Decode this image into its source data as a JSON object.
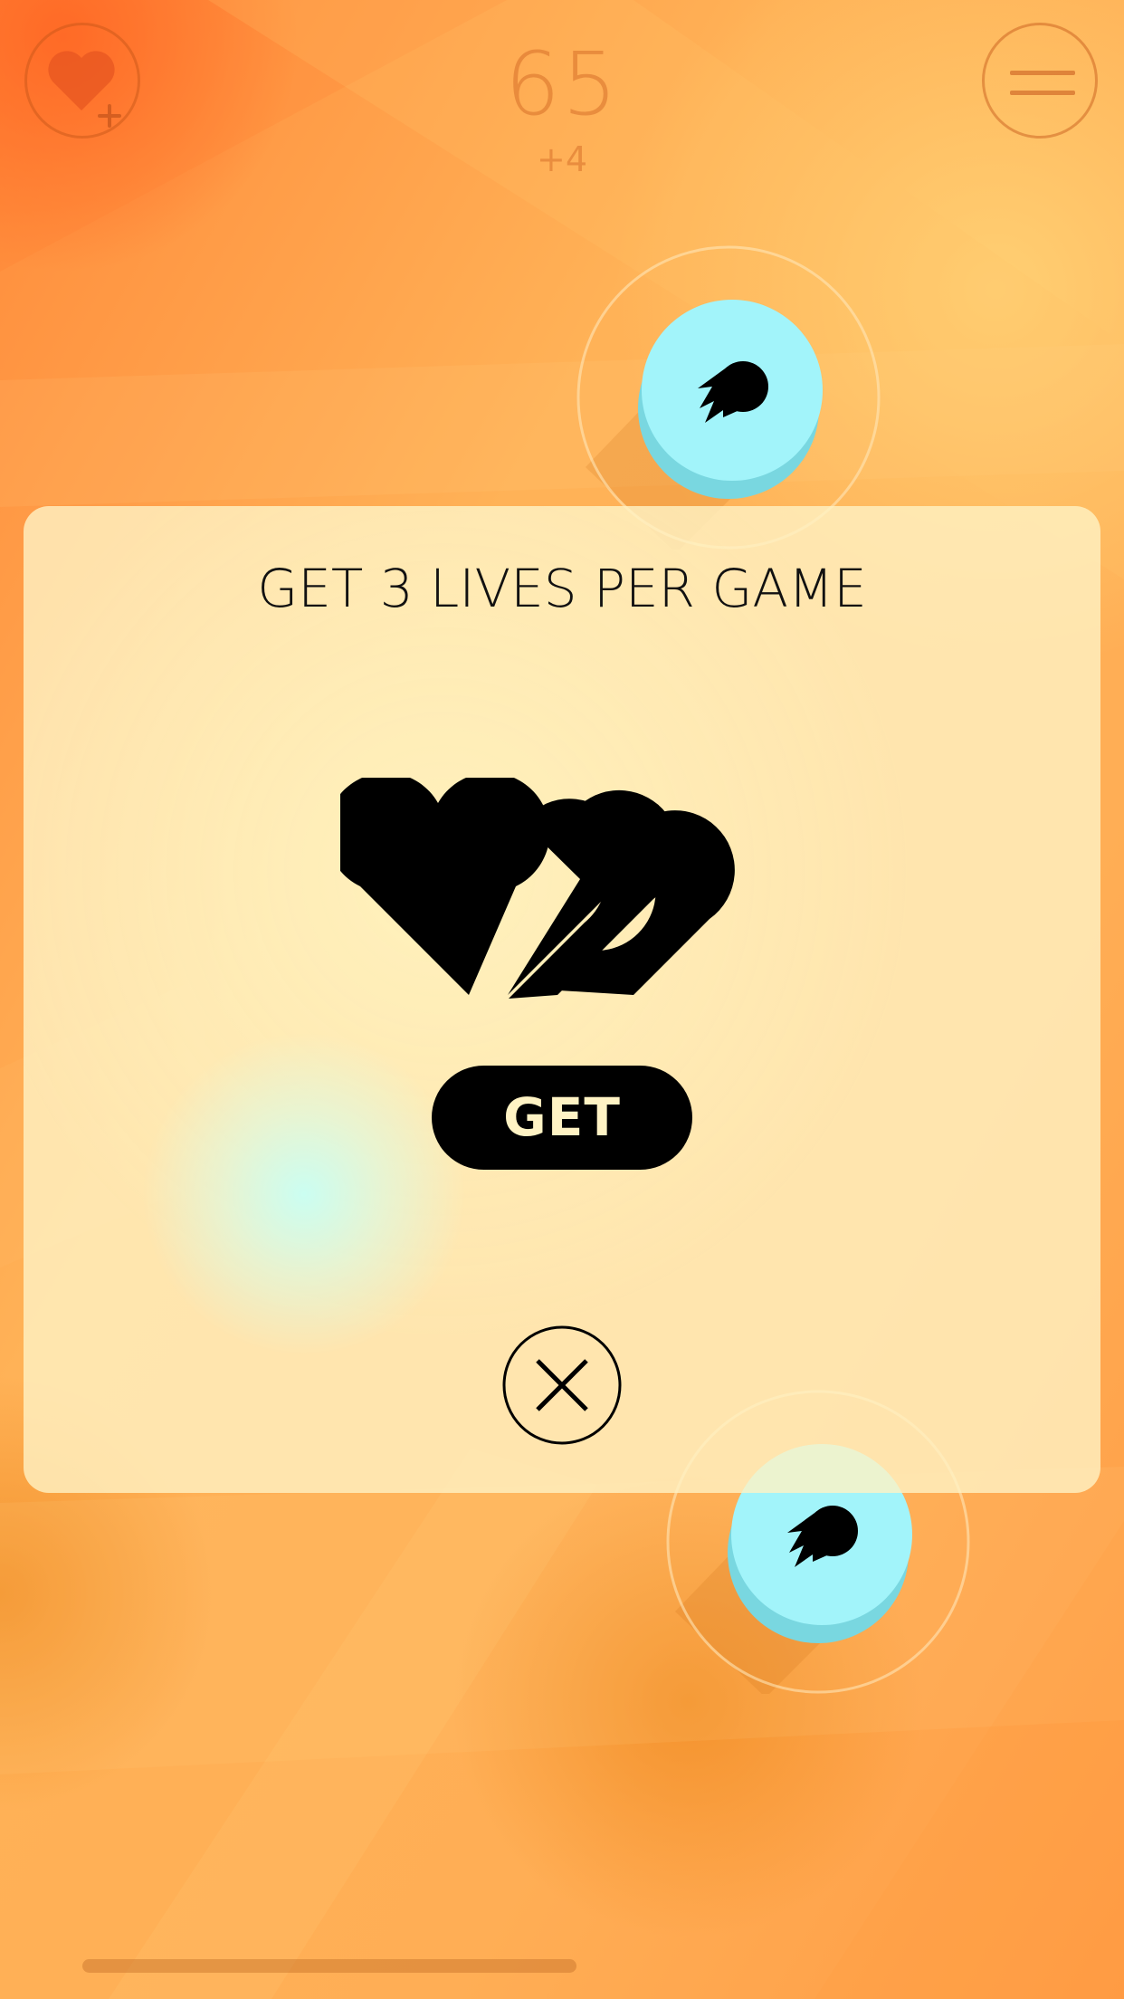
{
  "hud": {
    "score": "65",
    "score_bonus": "+4",
    "lives_button_icon": "heart-plus-icon",
    "menu_button_icon": "hamburger-menu-icon"
  },
  "game": {
    "balls": [
      {
        "icon": "comet-icon",
        "color": "#a2f4fa"
      },
      {
        "icon": "comet-icon",
        "color": "#a2f4fa"
      }
    ]
  },
  "dialog": {
    "title": "GET 3 LIVES PER GAME",
    "icon": "three-hearts-icon",
    "get_label": "GET",
    "close_icon": "close-icon"
  },
  "colors": {
    "background": "#ffa24d",
    "dialog": "#fff3c4",
    "ball": "#a2f4fa",
    "button": "#000000",
    "button_text": "#fff3c4"
  }
}
